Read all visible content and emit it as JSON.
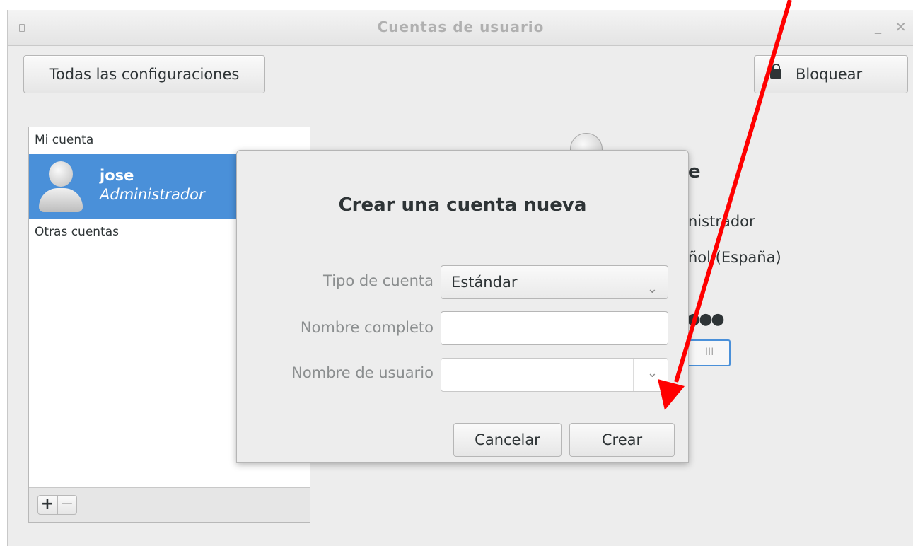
{
  "window": {
    "title": "Cuentas de usuario"
  },
  "header": {
    "settings_label": "Todas las configuraciones",
    "lock_label": "Bloquear"
  },
  "account_list": {
    "my_account_header": "Mi cuenta",
    "other_accounts_header": "Otras cuentas",
    "selected_user": {
      "name": "jose",
      "role": "Administrador"
    },
    "toolbar": {
      "add_label": "+",
      "remove_label": "−"
    }
  },
  "account_details": {
    "name_fragment": "e",
    "type_fragment": "nistrador",
    "language_fragment": "ñol (España)",
    "password_fragment": "●●●",
    "login_switch_fragment": "III"
  },
  "dialog": {
    "title": "Crear una cuenta nueva",
    "account_type_label": "Tipo de cuenta",
    "account_type_value": "Estándar",
    "full_name_label": "Nombre completo",
    "full_name_value": "",
    "username_label": "Nombre de usuario",
    "username_value": "",
    "cancel_label": "Cancelar",
    "create_label": "Crear"
  },
  "annotation": {
    "arrow_color": "#ff0000"
  },
  "colors": {
    "selection": "#4a90d9",
    "background": "#ededed"
  }
}
